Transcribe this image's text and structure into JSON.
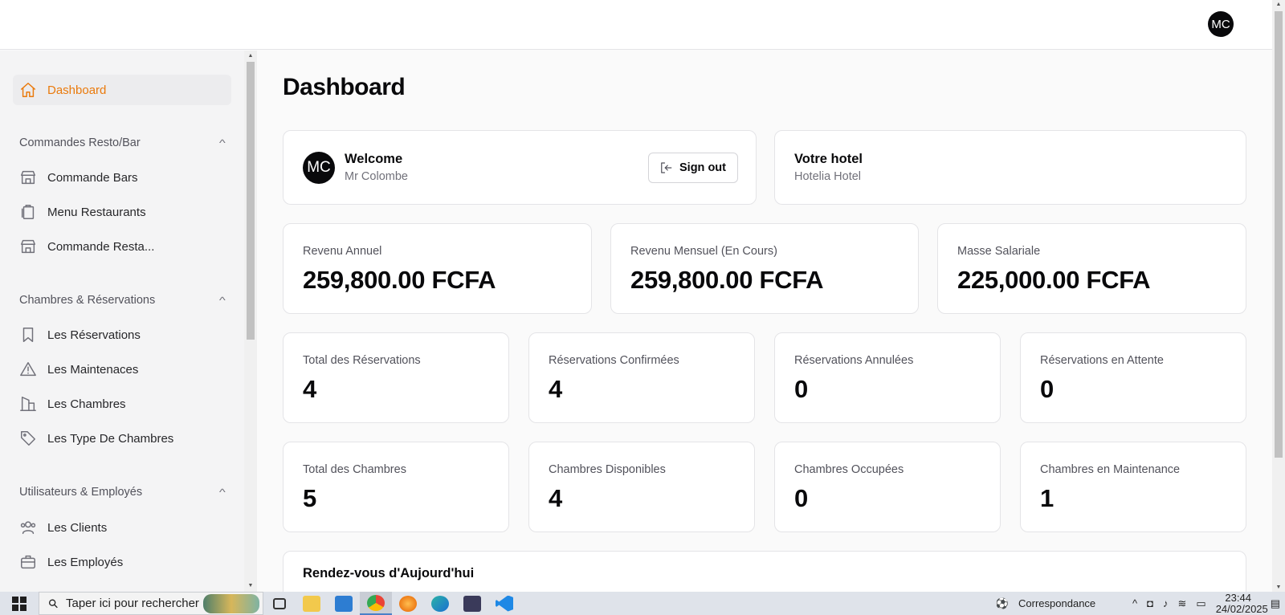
{
  "header": {
    "avatar_initials": "MC"
  },
  "sidebar": {
    "dashboard": {
      "label": "Dashboard",
      "icon": "home-icon"
    },
    "groups": [
      {
        "title": "Commandes Resto/Bar",
        "items": [
          {
            "label": "Commande Bars",
            "icon": "store-icon"
          },
          {
            "label": "Menu Restaurants",
            "icon": "clipboard-icon"
          },
          {
            "label": "Commande Resta...",
            "icon": "store-icon"
          }
        ]
      },
      {
        "title": "Chambres & Réservations",
        "items": [
          {
            "label": "Les Réservations",
            "icon": "bookmark-icon"
          },
          {
            "label": "Les Maintenaces",
            "icon": "alert-triangle-icon"
          },
          {
            "label": "Les Chambres",
            "icon": "building-icon"
          },
          {
            "label": "Les Type De Chambres",
            "icon": "tag-icon"
          }
        ]
      },
      {
        "title": "Utilisateurs & Employés",
        "items": [
          {
            "label": "Les Clients",
            "icon": "users-icon"
          },
          {
            "label": "Les Employés",
            "icon": "briefcase-icon"
          }
        ]
      }
    ]
  },
  "main": {
    "title": "Dashboard",
    "welcome": {
      "avatar_initials": "MC",
      "title": "Welcome",
      "name": "Mr Colombe",
      "signout_label": "Sign out"
    },
    "hotel": {
      "title": "Votre hotel",
      "name": "Hotelia Hotel"
    },
    "revenue_stats": [
      {
        "label": "Revenu Annuel",
        "value": "259,800.00 FCFA"
      },
      {
        "label": "Revenu Mensuel (En Cours)",
        "value": "259,800.00 FCFA"
      },
      {
        "label": "Masse Salariale",
        "value": "225,000.00 FCFA"
      }
    ],
    "reservation_stats": [
      {
        "label": "Total des Réservations",
        "value": "4"
      },
      {
        "label": "Réservations Confirmées",
        "value": "4"
      },
      {
        "label": "Réservations Annulées",
        "value": "0"
      },
      {
        "label": "Réservations en Attente",
        "value": "0"
      }
    ],
    "room_stats": [
      {
        "label": "Total des Chambres",
        "value": "5"
      },
      {
        "label": "Chambres Disponibles",
        "value": "4"
      },
      {
        "label": "Chambres Occupées",
        "value": "0"
      },
      {
        "label": "Chambres en Maintenance",
        "value": "1"
      }
    ],
    "appointments_title": "Rendez-vous d'Aujourd'hui"
  },
  "taskbar": {
    "search_placeholder": "Taper ici pour rechercher",
    "notification_text": "Correspondance",
    "time": "23:44",
    "date": "24/02/2025"
  }
}
